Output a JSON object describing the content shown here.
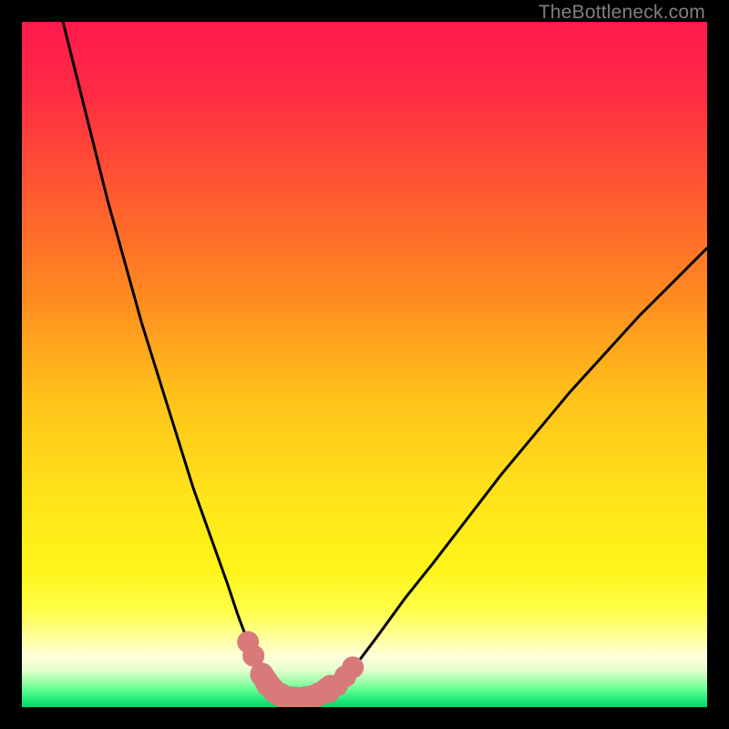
{
  "watermark": "TheBottleneck.com",
  "chart_data": {
    "type": "line",
    "title": "",
    "xlabel": "",
    "ylabel": "",
    "xlim": [
      0,
      100
    ],
    "ylim": [
      0,
      100
    ],
    "gradient_stops": [
      {
        "offset": 0,
        "color": "#ff1a4d"
      },
      {
        "offset": 0.1,
        "color": "#ff2a44"
      },
      {
        "offset": 0.25,
        "color": "#ff5a30"
      },
      {
        "offset": 0.4,
        "color": "#ff8a20"
      },
      {
        "offset": 0.55,
        "color": "#ffc31a"
      },
      {
        "offset": 0.7,
        "color": "#ffe51a"
      },
      {
        "offset": 0.8,
        "color": "#fff51a"
      },
      {
        "offset": 0.86,
        "color": "#ffff4a"
      },
      {
        "offset": 0.9,
        "color": "#ffffa0"
      },
      {
        "offset": 0.925,
        "color": "#ffffd8"
      },
      {
        "offset": 0.945,
        "color": "#e8ffd0"
      },
      {
        "offset": 0.96,
        "color": "#a8ffb0"
      },
      {
        "offset": 0.975,
        "color": "#60ff90"
      },
      {
        "offset": 0.99,
        "color": "#20e878"
      },
      {
        "offset": 1.0,
        "color": "#00d868"
      }
    ],
    "series": [
      {
        "name": "left-curve",
        "x": [
          6.0,
          8.0,
          10.0,
          12.5,
          15.0,
          17.5,
          20.0,
          22.5,
          25.0,
          27.5,
          30.0,
          31.5,
          33.0,
          34.0,
          35.0,
          35.8,
          36.5
        ],
        "y": [
          100.0,
          92.0,
          84.0,
          74.0,
          65.0,
          56.0,
          48.0,
          40.0,
          32.0,
          25.0,
          18.0,
          13.5,
          9.5,
          7.0,
          5.0,
          3.5,
          2.5
        ]
      },
      {
        "name": "valley-floor",
        "x": [
          36.5,
          37.5,
          39.0,
          41.0,
          43.0,
          44.5,
          45.5
        ],
        "y": [
          2.5,
          1.5,
          1.0,
          1.0,
          1.2,
          1.8,
          2.5
        ]
      },
      {
        "name": "right-curve",
        "x": [
          45.5,
          47.0,
          49.0,
          52.0,
          56.0,
          60.0,
          65.0,
          70.0,
          75.0,
          80.0,
          85.0,
          90.0,
          95.0,
          100.0
        ],
        "y": [
          2.5,
          4.0,
          6.5,
          10.5,
          16.0,
          21.0,
          27.5,
          34.0,
          40.0,
          46.0,
          51.5,
          57.0,
          62.0,
          67.0
        ]
      }
    ],
    "markers": {
      "name": "highlight-dots",
      "color": "#d87a7a",
      "radius": 1.6,
      "points": [
        {
          "x": 33.0,
          "y": 9.5
        },
        {
          "x": 33.8,
          "y": 7.5
        },
        {
          "x": 35.0,
          "y": 4.8
        },
        {
          "x": 35.8,
          "y": 3.2
        },
        {
          "x": 44.8,
          "y": 2.2
        },
        {
          "x": 46.0,
          "y": 3.2
        },
        {
          "x": 47.2,
          "y": 4.5
        },
        {
          "x": 48.3,
          "y": 5.8
        }
      ]
    },
    "thick_segment": {
      "name": "valley-highlight",
      "color": "#d87a7a",
      "width": 3.4,
      "x": [
        35.0,
        36.0,
        37.0,
        38.5,
        40.5,
        42.5,
        44.0,
        45.0
      ],
      "y": [
        4.8,
        3.3,
        2.2,
        1.4,
        1.2,
        1.5,
        2.2,
        3.0
      ]
    }
  }
}
